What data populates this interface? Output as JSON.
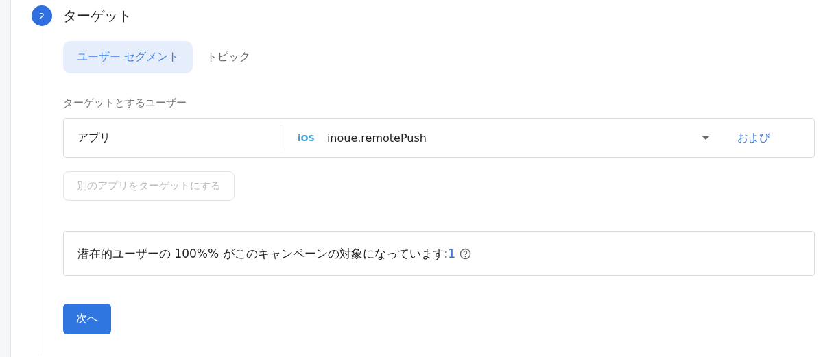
{
  "step": {
    "number": "2",
    "title": "ターゲット"
  },
  "tabs": [
    {
      "label": "ユーザー セグメント",
      "selected": true
    },
    {
      "label": "トピック",
      "selected": false
    }
  ],
  "target_label": "ターゲットとするユーザー",
  "condition": {
    "field": "アプリ",
    "platform": "iOS",
    "app": "inoue.remotePush",
    "and_link": "および"
  },
  "add_app_button": {
    "label": "別のアプリをターゲットにする",
    "disabled": true
  },
  "summary": {
    "text": "潜在的ユーザーの 100%% がこのキャンペーンの対象になっています:",
    "count": "1"
  },
  "next_button": "次へ"
}
